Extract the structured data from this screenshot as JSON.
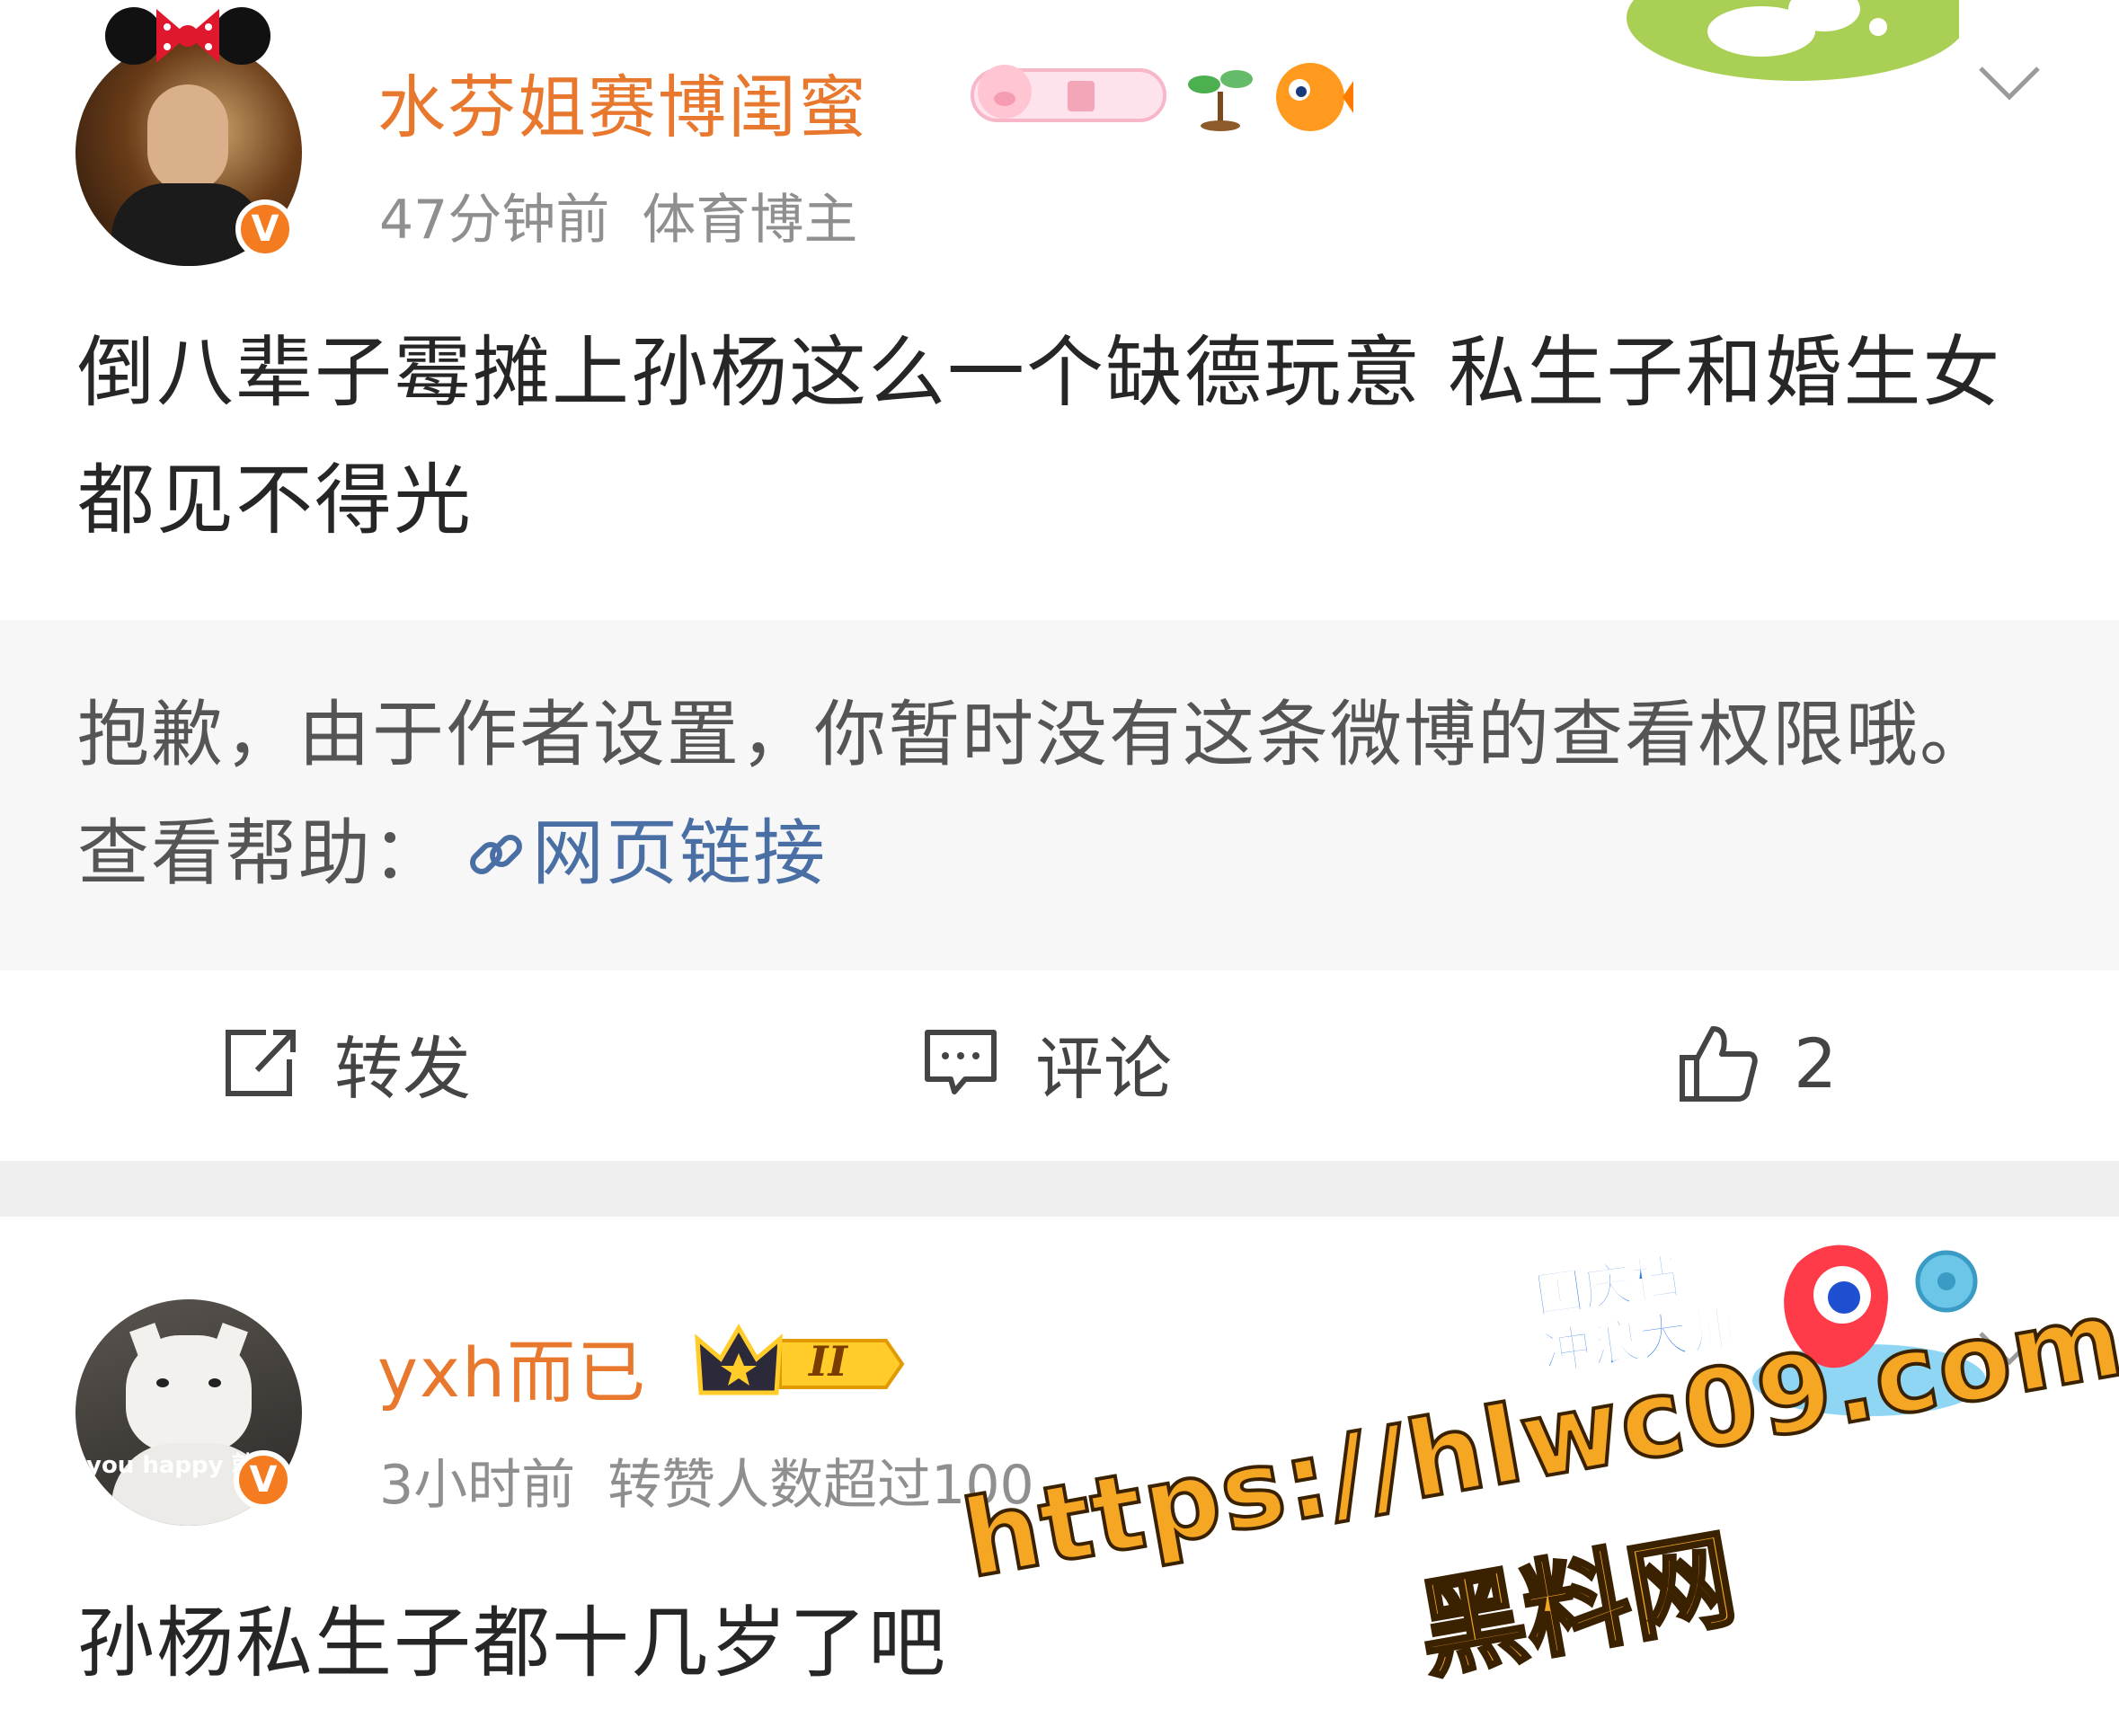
{
  "post1": {
    "user_name": "水芬姐赛博闺蜜",
    "time": "47分钟前",
    "tag": "体育博主",
    "verified_mark": "V",
    "content": "倒八辈子霉摊上孙杨这么一个缺德玩意 私生子和婚生女都见不得光",
    "notice_text": "抱歉，由于作者设置，你暂时没有这条微博的查看权限哦。查看帮助：",
    "notice_link": "网页链接",
    "actions": {
      "repost": "转发",
      "comment": "评论",
      "like_count": "2"
    }
  },
  "post2": {
    "user_name": "yxh而已",
    "time": "3小时前",
    "meta_extra": "转赞人数超过100",
    "verified_mark": "V",
    "avatar_caption": "you happy 就",
    "level_badge": "II",
    "content": "孙杨私生子都十几岁了吧"
  },
  "watermark": {
    "url": "https://hlwc09.com",
    "name": "黑料网",
    "sticker_line1": "国庆档",
    "sticker_line2": "冲浪大师"
  },
  "colors": {
    "name_orange": "#e8782e",
    "link_blue": "#4a6fa5",
    "badge_orange": "#f47b20"
  }
}
